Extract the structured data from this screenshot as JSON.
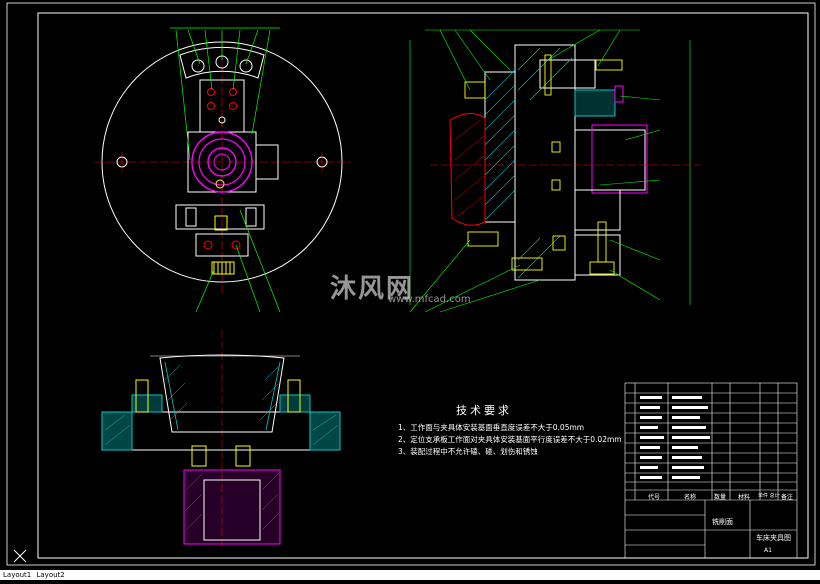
{
  "technical_requirements": {
    "title": "技术要求",
    "items": [
      "1、工作面与夹具体安装基面垂直度误差不大于0.05mm",
      "2、定位支承板工作面对夹具体安装基面平行度误差不大于0.02mm",
      "3、装配过程中不允许磕、碰、划伤和锈蚀"
    ]
  },
  "title_block": {
    "header": {
      "code": "代号",
      "name": "名称",
      "qty": "数量",
      "material": "材料",
      "weight": "单件 总计",
      "remark": "备注"
    },
    "drawing_name": "车床夹具图",
    "company": "铣削面",
    "sheet": "A1"
  },
  "watermark": {
    "brand": "沐风网",
    "url": "www.mfcad.com"
  },
  "layout_tabs": {
    "layout1": "Layout1",
    "layout2": "Layout2"
  },
  "colors": {
    "background": "#000000",
    "line": "#ffffff",
    "center": "#ff0000",
    "leader": "#00ff00",
    "section": "#00c8c8",
    "hole": "#ff00ff",
    "bolt": "#ffff00"
  }
}
